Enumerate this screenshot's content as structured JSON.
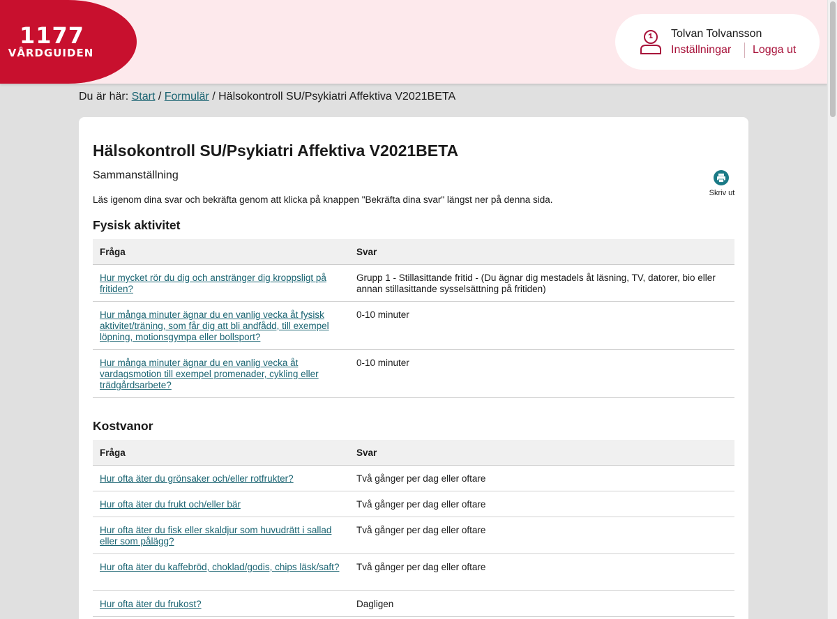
{
  "header": {
    "logo_number": "1177",
    "logo_text": "VÅRDGUIDEN",
    "user_name": "Tolvan Tolvansson",
    "settings_label": "Inställningar",
    "logout_label": "Logga ut",
    "icons": {
      "user": "person-icon"
    },
    "colors": {
      "brand": "#c8102e",
      "header_bg": "#fde9ec"
    }
  },
  "breadcrumb": {
    "prefix": "Du är här:",
    "start": "Start",
    "sep1": "/",
    "forms": "Formulär",
    "sep2": "/",
    "current": "Hälsokontroll SU/Psykiatri Affektiva V2021BETA"
  },
  "page": {
    "title": "Hälsokontroll SU/Psykiatri Affektiva V2021BETA",
    "subtitle": "Sammanställning",
    "intro": "Läs igenom dina svar och bekräfta genom att klicka på knappen \"Bekräfta dina svar\" längst ner på denna sida.",
    "print_label": "Skriv ut",
    "print_icon": "printer-icon",
    "link_color": "#1a6472"
  },
  "sections": [
    {
      "title": "Fysisk aktivitet",
      "col_question": "Fråga",
      "col_answer": "Svar",
      "rows": [
        {
          "q": "Hur mycket rör du dig och anstränger dig kroppsligt på fritiden?",
          "a": "Grupp 1 - Stillasittande fritid - (Du ägnar dig mestadels åt läsning, TV, datorer, bio eller annan stillasittande sysselsättning på fritiden)"
        },
        {
          "q": "Hur många minuter ägnar du en vanlig vecka åt fysisk aktivitet/träning, som får dig att bli andfådd, till exempel löpning, motionsgympa eller bollsport?",
          "a": "0-10 minuter"
        },
        {
          "q": "Hur många minuter ägnar du en vanlig vecka åt vardagsmotion till exempel promenader, cykling eller trädgårdsarbete?",
          "a": "0-10 minuter"
        }
      ]
    },
    {
      "title": "Kostvanor",
      "col_question": "Fråga",
      "col_answer": "Svar",
      "rows": [
        {
          "q": "Hur ofta äter du grönsaker och/eller rotfrukter?",
          "a": "Två gånger per dag eller oftare"
        },
        {
          "q": "Hur ofta äter du frukt och/eller bär",
          "a": "Två gånger per dag eller oftare"
        },
        {
          "q": "Hur ofta äter du fisk eller skaldjur som huvudrätt i sallad eller som pålägg?",
          "a": "Två gånger per dag eller oftare"
        },
        {
          "q": "Hur ofta äter du kaffebröd, choklad/godis, chips läsk/saft?",
          "a": "Två gånger per dag eller oftare"
        },
        {
          "q": "Hur ofta äter du frukost?",
          "a": "Dagligen"
        }
      ]
    }
  ]
}
